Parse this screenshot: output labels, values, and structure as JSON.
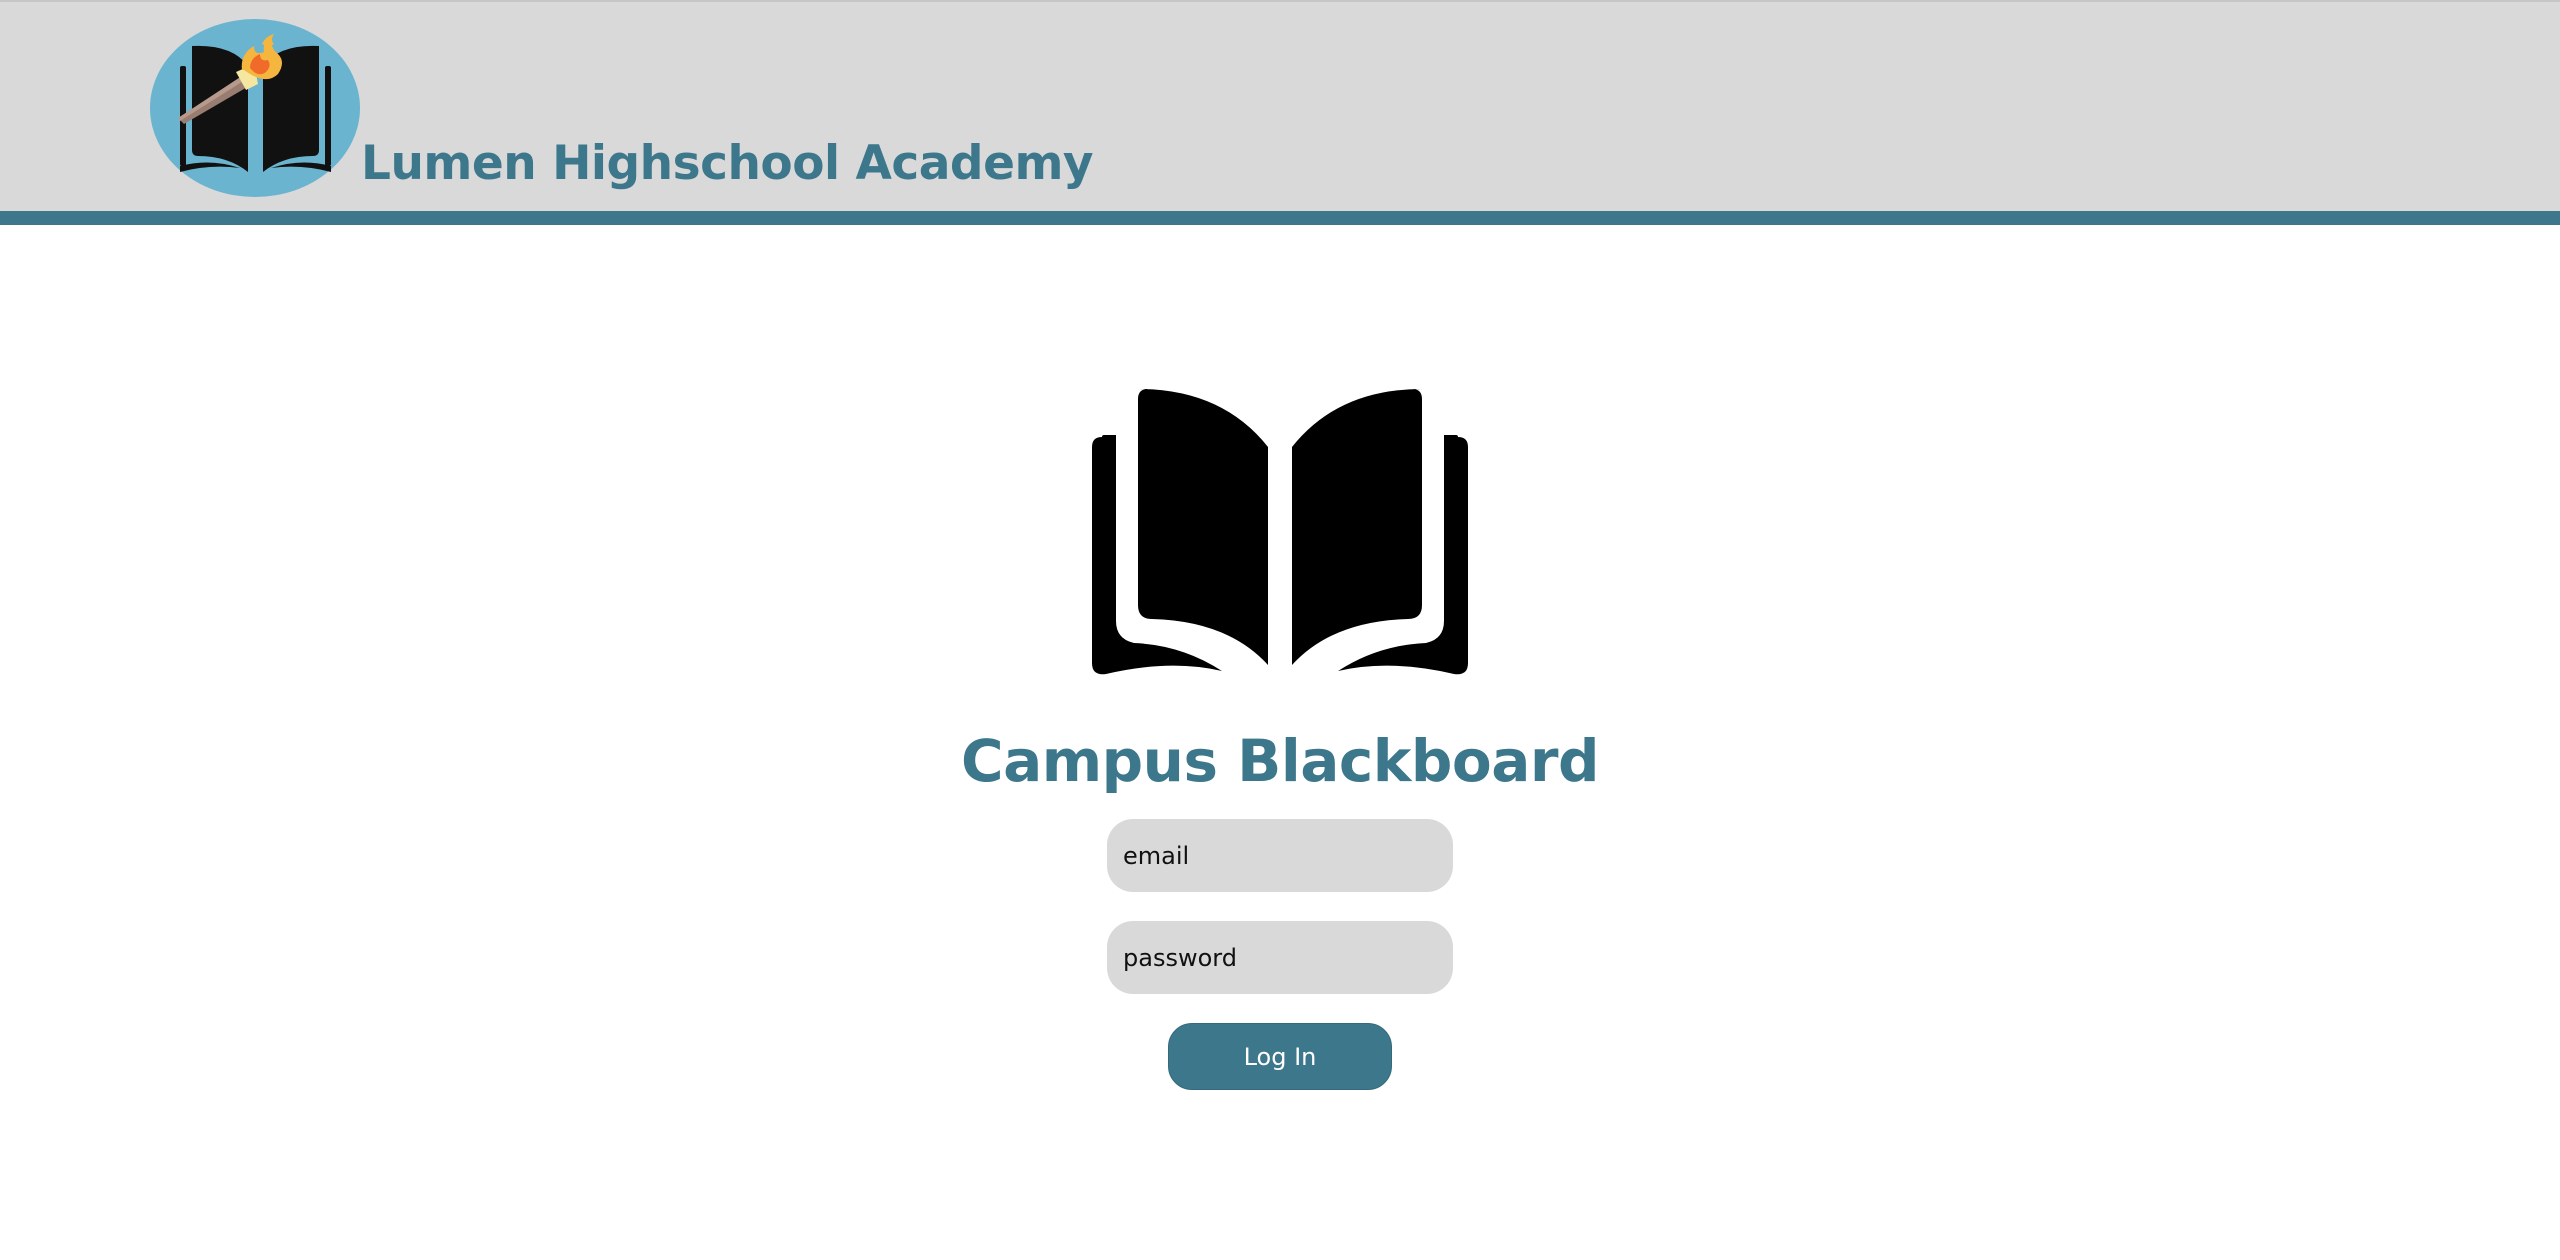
{
  "header": {
    "school_name": "Lumen Highschool Academy",
    "logo_icon": "torch-book-logo-icon"
  },
  "main": {
    "hero_icon": "open-book-icon",
    "title": "Campus Blackboard"
  },
  "login_form": {
    "email_placeholder": "email",
    "email_value": "",
    "password_placeholder": "password",
    "password_value": "",
    "submit_label": "Log In"
  },
  "colors": {
    "accent": "#3c778b",
    "header_bg": "#d9d9d9",
    "field_bg": "#d9d9d9",
    "logo_circle": "#6ab4cf",
    "page_bg": "#ffffff"
  }
}
